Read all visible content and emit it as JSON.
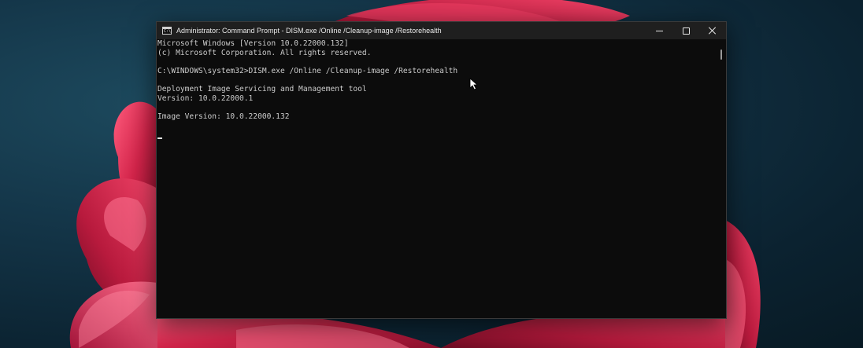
{
  "window": {
    "title": "Administrator: Command Prompt - DISM.exe  /Online /Cleanup-image /Restorehealth",
    "icon": "command-prompt-icon",
    "icon_label": "C:\\"
  },
  "caption_buttons": {
    "minimize": "minimize-icon",
    "maximize": "maximize-icon",
    "close": "close-icon"
  },
  "console": {
    "lines": [
      "Microsoft Windows [Version 10.0.22000.132]",
      "(c) Microsoft Corporation. All rights reserved.",
      "",
      "C:\\WINDOWS\\system32>DISM.exe /Online /Cleanup-image /Restorehealth",
      "",
      "Deployment Image Servicing and Management tool",
      "Version: 10.0.22000.1",
      "",
      "Image Version: 10.0.22000.132",
      ""
    ]
  },
  "colors": {
    "console_background": "#0c0c0c",
    "console_text": "#cccccc",
    "titlebar": "#1f1f1f",
    "wallpaper_petal": "#d8294f"
  }
}
